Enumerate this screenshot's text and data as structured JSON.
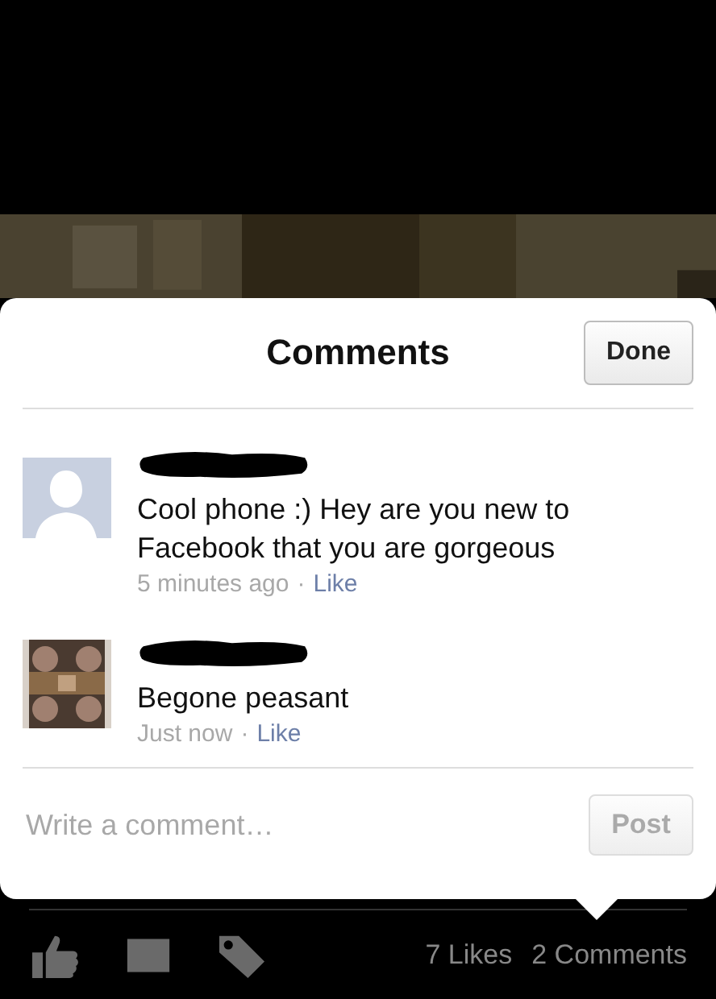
{
  "title": "Comments",
  "done_button": "Done",
  "comments": [
    {
      "kind": "silhouette",
      "name_hidden": true,
      "text": "Cool phone :) Hey are you new to Facebook that you are gorgeous",
      "time": "5 minutes ago",
      "separator": "·",
      "like": "Like"
    },
    {
      "name_hidden": true,
      "text": "Begone peasant",
      "time": "Just now",
      "separator": "·",
      "like": "Like"
    }
  ],
  "composer": {
    "placeholder": "Write a comment…",
    "post_button": "Post",
    "disabled": true
  },
  "footer": {
    "likes": "7 Likes",
    "comments": "2 Comments"
  }
}
